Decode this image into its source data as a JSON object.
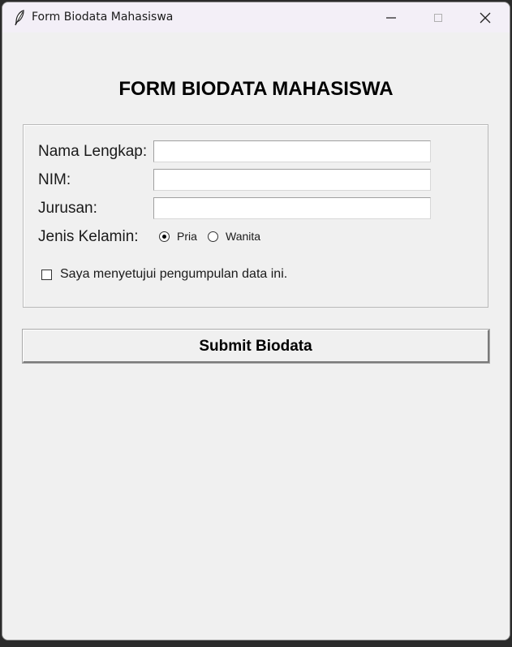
{
  "window": {
    "title": "Form Biodata Mahasiswa",
    "icon": "feather-icon"
  },
  "form": {
    "title": "FORM BIODATA MAHASISWA",
    "fields": {
      "nama_label": "Nama Lengkap:",
      "nim_label": "NIM:",
      "jurusan_label": "Jurusan:",
      "gender_label": "Jenis Kelamin:"
    },
    "values": {
      "nama": "",
      "nim": "",
      "jurusan": ""
    },
    "gender": {
      "options": [
        "Pria",
        "Wanita"
      ],
      "selected": "Pria"
    },
    "consent": {
      "label": "Saya menyetujui pengumpulan data ini.",
      "checked": false
    },
    "submit_label": "Submit Biodata"
  }
}
